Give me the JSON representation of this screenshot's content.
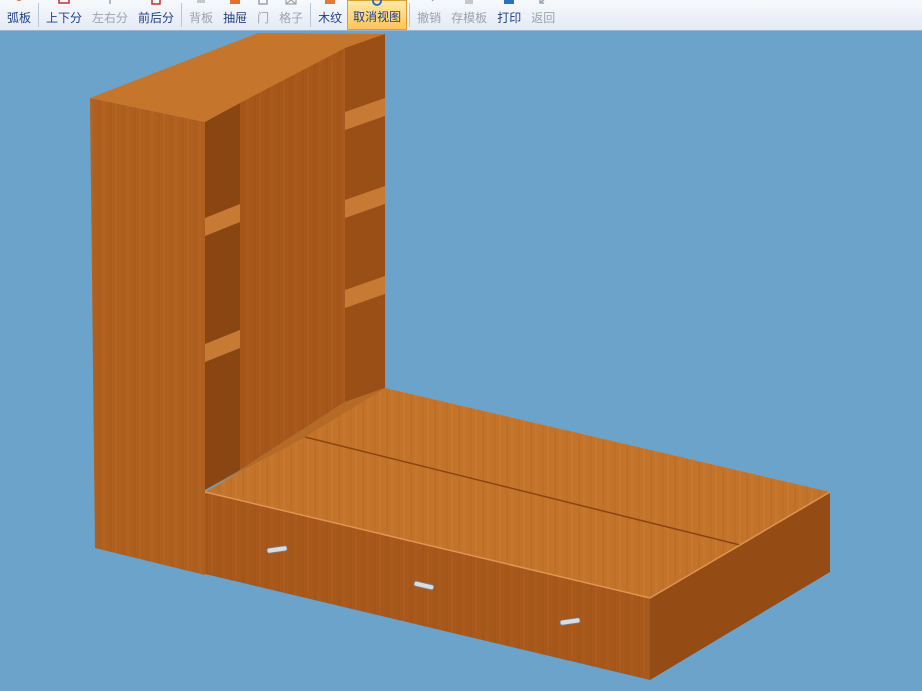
{
  "toolbar": {
    "buttons": [
      {
        "label": "弧板",
        "icon": "arc-panel-icon",
        "enabled": true
      },
      {
        "label": "上下分",
        "icon": "split-vertical-icon",
        "enabled": true
      },
      {
        "label": "左右分",
        "icon": "split-horizontal-icon",
        "enabled": false
      },
      {
        "label": "前后分",
        "icon": "split-depth-icon",
        "enabled": true
      },
      {
        "label": "背板",
        "icon": "back-panel-icon",
        "enabled": false
      },
      {
        "label": "抽屉",
        "icon": "drawer-icon",
        "enabled": true
      },
      {
        "label": "门",
        "icon": "door-icon",
        "enabled": false
      },
      {
        "label": "格子",
        "icon": "grid-icon",
        "enabled": false
      },
      {
        "label": "木纹",
        "icon": "wood-grain-icon",
        "enabled": true
      },
      {
        "label": "取消视图",
        "icon": "cancel-view-icon",
        "enabled": true,
        "active": true
      },
      {
        "label": "撤销",
        "icon": "undo-icon",
        "enabled": false
      },
      {
        "label": "存模板",
        "icon": "save-template-icon",
        "enabled": false
      },
      {
        "label": "打印",
        "icon": "print-icon",
        "enabled": true
      },
      {
        "label": "返回",
        "icon": "back-icon",
        "enabled": false
      }
    ]
  },
  "viewport": {
    "background": "#6ba3cb",
    "wood_colors": {
      "front": "#b4641c",
      "side": "#8e4a12",
      "top": "#c8782e",
      "inner": "#a5581a"
    },
    "drawer_count": 3
  }
}
